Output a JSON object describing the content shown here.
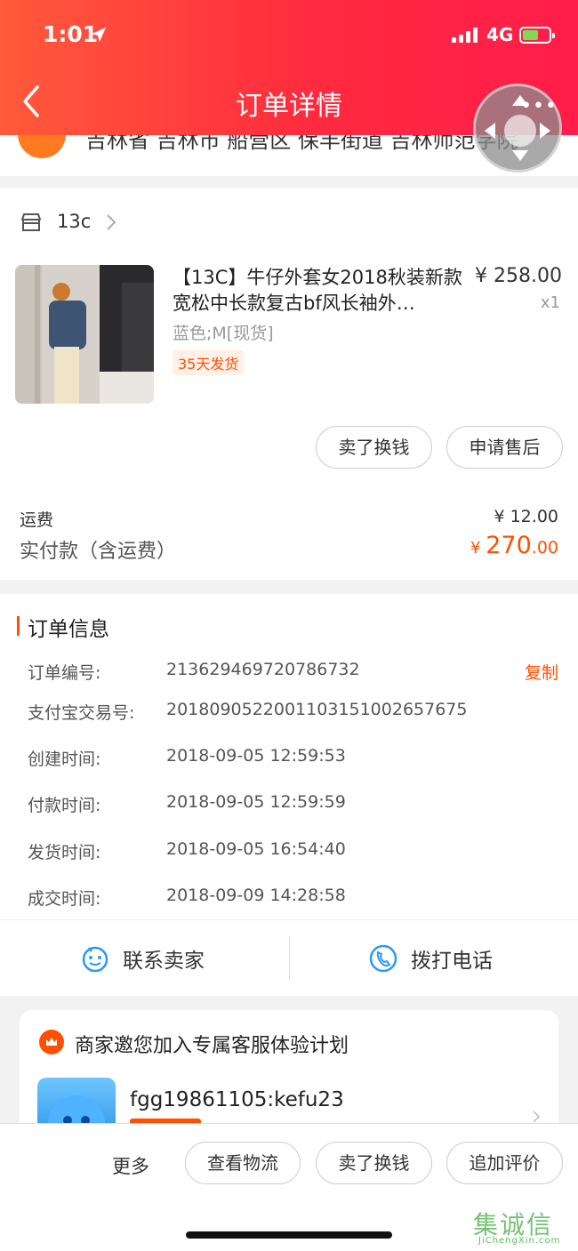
{
  "status_bar": {
    "time": "1:01",
    "network": "4G"
  },
  "nav": {
    "title": "订单详情"
  },
  "address": {
    "text": "吉林省 吉林市 船营区 保丰街道 吉林师范学院"
  },
  "shop": {
    "name": "13c",
    "product": {
      "title": "【13C】牛仔外套女2018秋装新款宽松中长款复古bf风长袖外…",
      "price": "¥ 258.00",
      "qty": "x1",
      "variant": "蓝色;M[现货]",
      "tag": "35天发货"
    },
    "actions": {
      "sell_label": "卖了换钱",
      "aftersale_label": "申请售后"
    },
    "shipping_label": "运费",
    "shipping_value": "¥ 12.00",
    "paid_label": "实付款（含运费）",
    "paid_currency": "¥ ",
    "paid_int": "270",
    "paid_dec": ".00"
  },
  "order_info": {
    "title": "订单信息",
    "copy_label": "复制",
    "rows": [
      {
        "label": "订单编号:",
        "value": "213629469720786732"
      },
      {
        "label": "支付宝交易号:",
        "value": "2018090522001103151002657675"
      },
      {
        "label": "创建时间:",
        "value": "2018-09-05 12:59:53"
      },
      {
        "label": "付款时间:",
        "value": "2018-09-05 12:59:59"
      },
      {
        "label": "发货时间:",
        "value": "2018-09-05 16:54:40"
      },
      {
        "label": "成交时间:",
        "value": "2018-09-09 14:28:58"
      }
    ],
    "contact_seller": "联系卖家",
    "call_phone": "拨打电话"
  },
  "promo": {
    "title": "商家邀您加入专属客服体验计划",
    "user": "fgg19861105:kefu23"
  },
  "bottom": {
    "more": "更多",
    "logistics": "查看物流",
    "sell": "卖了换钱",
    "review": "追加评价"
  },
  "watermark": {
    "main": "集诚信",
    "sub": "JiChengXin.com"
  },
  "colors": {
    "accent": "#ff5000",
    "header_start": "#ff5a3a",
    "header_end": "#ff1d4b"
  }
}
